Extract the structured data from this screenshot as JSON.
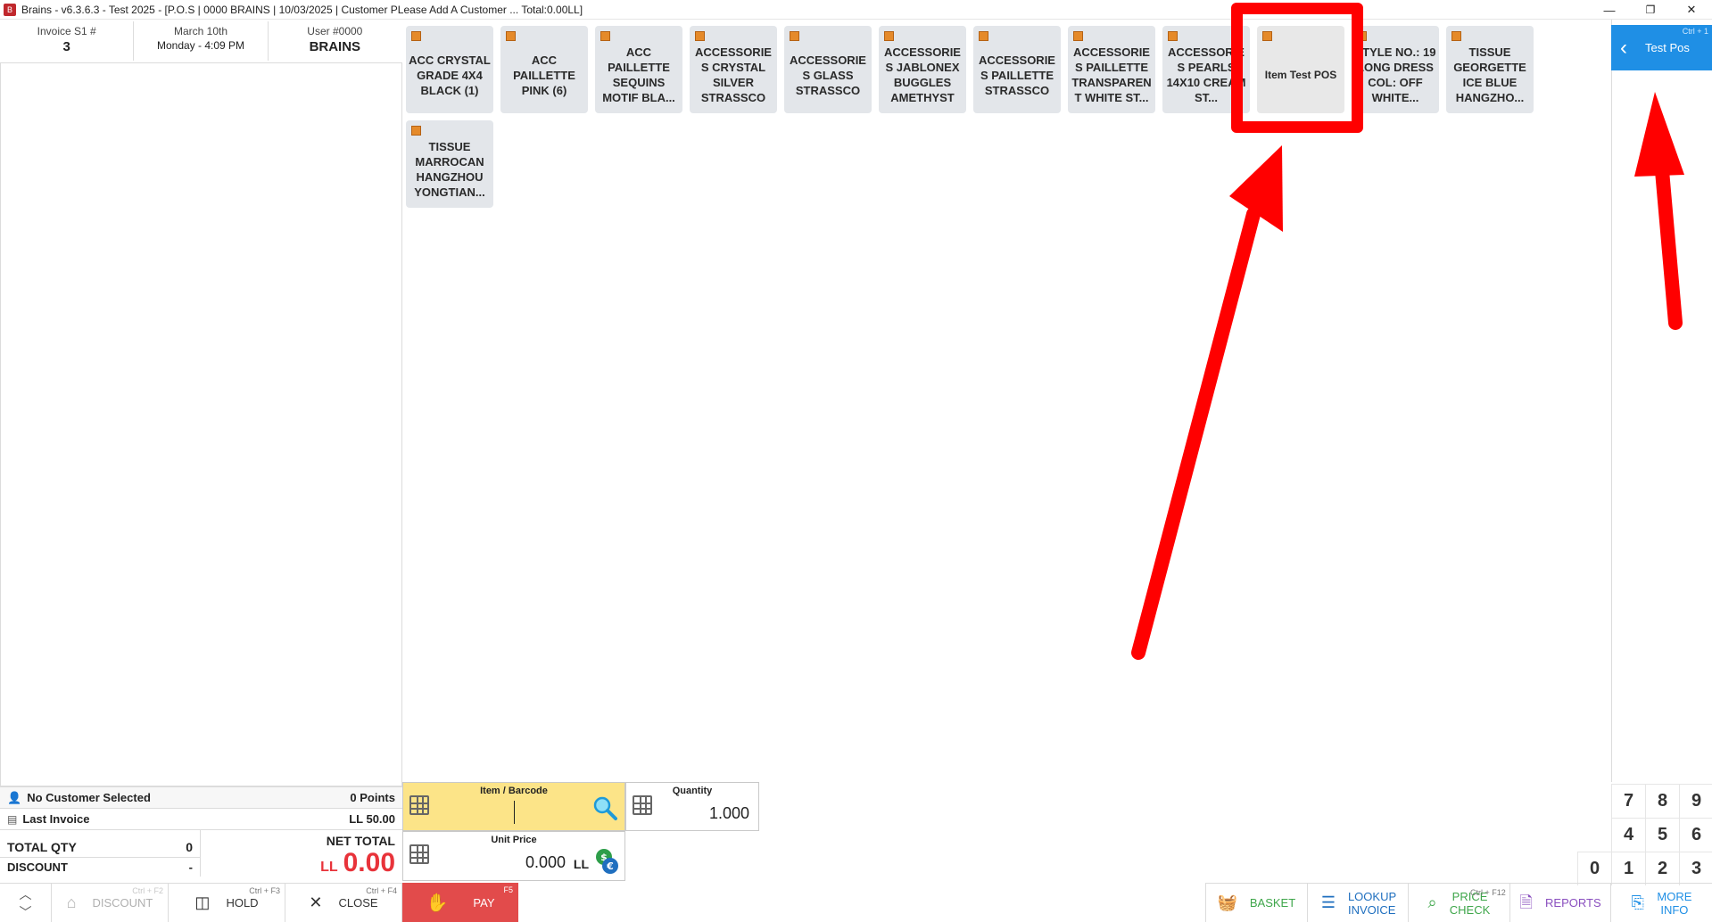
{
  "window": {
    "title": "Brains - v6.3.6.3 - Test 2025 - [P.O.S | 0000 BRAINS | 10/03/2025 | Customer  PLease Add A Customer ...   Total:0.00LL]",
    "minimize": "—",
    "restore": "❐",
    "close": "✕"
  },
  "header": {
    "invoice_label": "Invoice S1 #",
    "invoice_number": "3",
    "date_label": "March 10th",
    "date_value": "Monday - 4:09 PM",
    "user_label": "User #0000",
    "user_name": "BRAINS"
  },
  "customer": {
    "name": "No Customer Selected",
    "points": "0 Points",
    "last_invoice_label": "Last Invoice",
    "last_invoice_value": "LL 50.00"
  },
  "totals": {
    "total_qty_label": "TOTAL QTY",
    "total_qty_value": "0",
    "discount_label": "DISCOUNT",
    "discount_value": "-",
    "net_total_label": "NET TOTAL",
    "currency": "LL",
    "net_total_value": "0.00"
  },
  "actions_left": {
    "discount": {
      "label": "DISCOUNT",
      "shortcut": "Ctrl + F2"
    },
    "hold": {
      "label": "HOLD",
      "shortcut": "Ctrl + F3"
    },
    "close": {
      "label": "CLOSE",
      "shortcut": "Ctrl + F4"
    },
    "pay": {
      "label": "PAY",
      "shortcut": "F5"
    }
  },
  "fields": {
    "item_label": "Item / Barcode",
    "item_value": "",
    "quantity_label": "Quantity",
    "quantity_value": "1.000",
    "unit_price_label": "Unit Price",
    "unit_price_value": "0.000",
    "unit_price_currency": "LL"
  },
  "items": [
    "ACC CRYSTAL GRADE 4X4 BLACK (1)",
    "ACC PAILLETTE PINK (6)",
    "ACC PAILLETTE SEQUINS MOTIF BLA...",
    "ACCESSORIES CRYSTAL SILVER STRASSCO",
    "ACCESSORIES GLASS STRASSCO",
    "ACCESSORIES JABLONEX BUGGLES AMETHYST",
    "ACCESSORIES PAILLETTE STRASSCO",
    "ACCESSORIES PAILLETTE TRANSPAREN T WHITE ST...",
    "ACCESSORIES PEARLS 14X10 CREAM ST...",
    "Item Test POS",
    "STYLE NO.: 19 LONG DRESS COL: OFF WHITE...",
    "TISSUE GEORGETTE ICE BLUE HANGZHO...",
    "TISSUE MARROCAN HANGZHOU YONGTIAN..."
  ],
  "category": {
    "label": "Test Pos",
    "shortcut": "Ctrl + 1"
  },
  "numpad": [
    "7",
    "8",
    "9",
    "4",
    "5",
    "6",
    "0",
    "1",
    "2",
    "3"
  ],
  "actions_right": {
    "basket": {
      "label": "BASKET",
      "color": "#3ea64a"
    },
    "lookup": {
      "label": "LOOKUP INVOICE",
      "color": "#1f6fbf"
    },
    "price_check": {
      "label": "PRICE CHECK",
      "shortcut": "Ctrl + F12",
      "color": "#3ea64a"
    },
    "reports": {
      "label": "REPORTS",
      "color": "#8a4fbf"
    },
    "more_info": {
      "label": "MORE INFO",
      "color": "#1f8fe5"
    }
  },
  "colors": {
    "accent_blue": "#1f8fe5",
    "pay_red": "#e24b4b",
    "net_total_red": "#e8333a",
    "barcode_yellow": "#fce488",
    "annotation_red": "#ff0000"
  }
}
